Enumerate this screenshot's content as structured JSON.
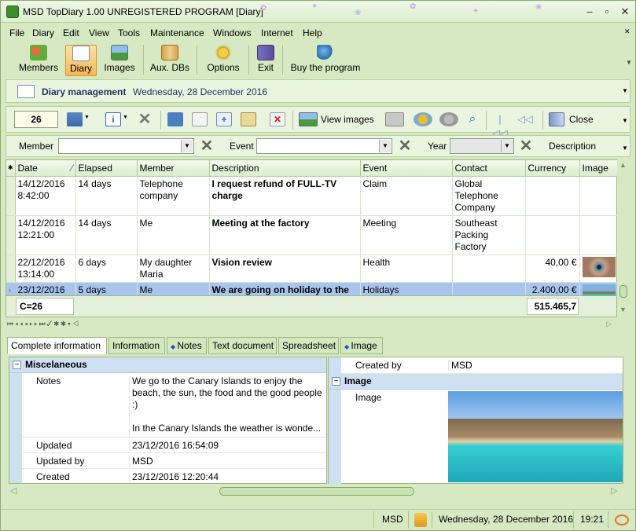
{
  "window": {
    "title": "MSD TopDiary 1.00 UNREGISTERED PROGRAM [Diary]"
  },
  "menu": [
    "File",
    "Diary",
    "Edit",
    "View",
    "Tools",
    "Maintenance",
    "Windows",
    "Internet",
    "Help"
  ],
  "toolbar": {
    "members": "Members",
    "diary": "Diary",
    "images": "Images",
    "aux": "Aux. DBs",
    "options": "Options",
    "exit": "Exit",
    "buy": "Buy the program"
  },
  "diarybar": {
    "title": "Diary management",
    "date": "Wednesday, 28 December 2016"
  },
  "nav": {
    "count": "26",
    "view_images": "View images",
    "close": "Close"
  },
  "filters": {
    "member_label": "Member",
    "event_label": "Event",
    "year_label": "Year",
    "description_label": "Description"
  },
  "grid": {
    "columns": [
      "Date",
      "Elapsed",
      "Member",
      "Description",
      "Event",
      "Contact",
      "Currency",
      "Image"
    ],
    "rows": [
      {
        "date": "14/12/2016 8:42:00",
        "elapsed": "14 days",
        "member": "Telephone company",
        "description": "I request refund of FULL-TV charge",
        "event": "Claim",
        "contact": "Global Telephone Company",
        "currency": ""
      },
      {
        "date": "14/12/2016 12:21:00",
        "elapsed": "14 days",
        "member": "Me",
        "description": "Meeting at the factory",
        "event": "Meeting",
        "contact": "Southeast Packing Factory",
        "currency": ""
      },
      {
        "date": "22/12/2016 13:14:00",
        "elapsed": "6 days",
        "member": "My daughter Maria",
        "description": "Vision review",
        "event": "Health",
        "contact": "",
        "currency": "40,00 €"
      },
      {
        "date": "23/12/2016 12:18:00",
        "elapsed": "5 days",
        "member": "Me",
        "description": "We are going on holiday to the Canary Islands",
        "event": "Holidays",
        "contact": "",
        "currency": "2.400,00 €"
      }
    ],
    "footer_count": "C=26",
    "footer_total": "515.465,7"
  },
  "tabs": [
    "Complete information",
    "Information",
    "Notes",
    "Text document",
    "Spreadsheet",
    "Image"
  ],
  "info": {
    "section_misc": "Miscelaneous",
    "notes_label": "Notes",
    "notes_value": "We go to the Canary Islands to enjoy the beach, the sun, the food and the good people :)",
    "notes_value2": "In the Canary Islands the weather is wonde...",
    "updated_label": "Updated",
    "updated_value": "23/12/2016 16:54:09",
    "updatedby_label": "Updated by",
    "updatedby_value": "MSD",
    "created_label": "Created",
    "created_value": "23/12/2016 12:20:44",
    "createdby_label": "Created by",
    "createdby_value": "MSD",
    "section_image": "Image",
    "image_label": "Image"
  },
  "status": {
    "user": "MSD",
    "date": "Wednesday, 28 December 2016",
    "time": "19:21"
  }
}
